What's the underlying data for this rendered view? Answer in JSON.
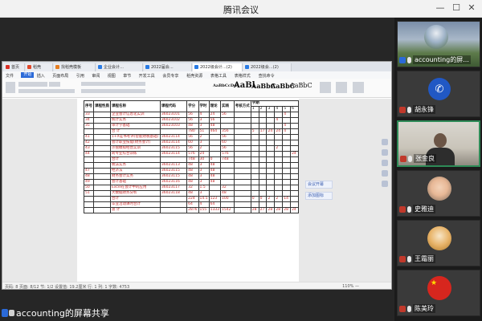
{
  "window": {
    "title": "腾讯会议",
    "minimize": "—",
    "maximize": "☐",
    "close": "✕"
  },
  "shared_screen": {
    "tabs": [
      {
        "label": "首页",
        "color": "#d93025"
      },
      {
        "label": "稻壳",
        "color": "#e0482a"
      },
      {
        "label": "找稻壳模板",
        "color": "#e67e22"
      },
      {
        "label": "企业会计…",
        "color": "#2a7be4"
      },
      {
        "label": "2022届会…",
        "color": "#2a7be4"
      },
      {
        "label": "2022级会计…(2)",
        "color": "#2a7be4"
      },
      {
        "label": "2022级会…(2)",
        "color": "#2a7be4"
      }
    ],
    "menu": [
      "文件",
      "开始",
      "插入",
      "页面布局",
      "引用",
      "审阅",
      "视图",
      "章节",
      "开发工具",
      "会员专享",
      "稻壳资源",
      "表格工具",
      "表格样式",
      "查找命令"
    ],
    "style_samples": [
      "AaBbCcDd",
      "AaBl",
      "AaBbC",
      "AaBbC",
      "AaBbC"
    ],
    "side_buttons": [
      "会议开幕",
      "添加图标"
    ],
    "table": {
      "headers": [
        "序号",
        "课程性质",
        "课程名称",
        "课程代码",
        "学分",
        "学时",
        "理论",
        "实践",
        "考核方式",
        "学期"
      ],
      "semesters": [
        "1",
        "2",
        "3",
        "4",
        "5",
        "6"
      ],
      "rows": [
        {
          "no": "33",
          "name": "企业会计信息化实训",
          "code": "36023101",
          "credit": "56",
          "hours": "4",
          "theory": "24",
          "practice": "56",
          "exam": "",
          "sem": [
            "",
            "",
            "",
            "",
            "4",
            ""
          ]
        },
        {
          "no": "34",
          "name": "统计实务",
          "code": "36023102",
          "credit": "56",
          "hours": "3",
          "theory": "56",
          "practice": "",
          "exam": "",
          "sem": [
            "",
            "",
            "",
            "4",
            "",
            ""
          ]
        },
        {
          "no": "35",
          "name": "审计学基础",
          "code": "36023103",
          "credit": "48",
          "hours": "3",
          "theory": "48",
          "practice": "",
          "exam": "",
          "sem": [
            "",
            "",
            "",
            "",
            "4",
            ""
          ]
        },
        {
          "no": "",
          "name": "合  计",
          "code": "",
          "credit": "780",
          "hours": "51",
          "theory": "464",
          "practice": "356",
          "exam": "",
          "sem": [
            "5",
            "17",
            "24",
            "24",
            "4",
            ""
          ]
        },
        {
          "no": "41",
          "name": "1+X证书考评(智能财税基础)",
          "code": "36023114",
          "credit": "56",
          "hours": "2",
          "theory": "",
          "practice": "56",
          "exam": "",
          "sem": [
            "",
            "",
            "",
            "",
            "",
            ""
          ]
        },
        {
          "no": "42",
          "name": "会计职业技能(财务会计)",
          "code": "36023114",
          "credit": "60",
          "hours": "3",
          "theory": "",
          "practice": "60",
          "exam": "",
          "sem": [
            "",
            "",
            "",
            "",
            "",
            ""
          ]
        },
        {
          "no": "43",
          "name": "沙盘模拟经营实训",
          "code": "36023115",
          "credit": "56",
          "hours": "2",
          "theory": "",
          "practice": "56",
          "exam": "",
          "sem": [
            "",
            "",
            "",
            "2",
            "",
            ""
          ]
        },
        {
          "no": "44",
          "name": "跨专业综合训练",
          "code": "36023114",
          "credit": "576",
          "hours": "24",
          "theory": "",
          "practice": "576",
          "exam": "",
          "sem": [
            "",
            "",
            "",
            "",
            "",
            "24"
          ]
        },
        {
          "no": "",
          "name": "合计",
          "code": "",
          "credit": "748",
          "hours": "30",
          "theory": "0",
          "practice": "748",
          "exam": "",
          "sem": [
            "",
            "",
            "",
            "",
            "",
            ""
          ]
        },
        {
          "no": "",
          "name": "税法实务",
          "code": "36023113",
          "credit": "48",
          "hours": "3",
          "theory": "48",
          "practice": "",
          "exam": "",
          "sem": [
            "",
            "",
            "",
            "",
            "",
            ""
          ]
        },
        {
          "no": "47",
          "name": "经济法",
          "code": "36023115",
          "credit": "48",
          "hours": "3",
          "theory": "48",
          "practice": "",
          "exam": "",
          "sem": [
            "",
            "",
            "",
            "",
            "",
            ""
          ]
        },
        {
          "no": "48",
          "name": "财务会计实务",
          "code": "36023115",
          "credit": "48",
          "hours": "3",
          "theory": "48",
          "practice": "",
          "exam": "",
          "sem": [
            "",
            "",
            "",
            "",
            "",
            ""
          ]
        },
        {
          "no": "49",
          "name": "会计基础",
          "code": "36023116",
          "credit": "48",
          "hours": "3",
          "theory": "48",
          "practice": "",
          "exam": "",
          "sem": [
            "",
            "",
            "",
            "",
            "",
            ""
          ]
        },
        {
          "no": "50",
          "name": "Excel在会计中的应用",
          "code": "36023117",
          "credit": "32",
          "hours": "1.5",
          "theory": "",
          "practice": "32",
          "exam": "",
          "sem": [
            "",
            "",
            "",
            "",
            "",
            ""
          ]
        },
        {
          "no": "51",
          "name": "大数据财务分析",
          "code": "36023118",
          "credit": "48",
          "hours": "3",
          "theory": "",
          "practice": "48",
          "exam": "",
          "sem": [
            "",
            "",
            "",
            "",
            "",
            ""
          ]
        },
        {
          "no": "",
          "name": "合计",
          "code": "",
          "credit": "224",
          "hours": "14.5",
          "theory": "123",
          "practice": "100",
          "exam": "",
          "sem": [
            "0",
            "0",
            "2",
            "2",
            "14",
            ""
          ]
        },
        {
          "no": "",
          "name": "毕业活动课时合计",
          "code": "",
          "credit": "64",
          "hours": "4",
          "theory": "64",
          "practice": "",
          "exam": "",
          "sem": [
            "",
            "",
            "",
            "",
            "",
            ""
          ]
        },
        {
          "no": "",
          "name": "总  计",
          "code": "",
          "credit": "2876",
          "hours": "155",
          "theory": "1333",
          "practice": "1542",
          "exam": "",
          "sem": [
            "28",
            "27",
            "28",
            "28",
            "28",
            "24"
          ]
        }
      ]
    },
    "status": {
      "left": "页码: 8  页面: 8/12  节: 1/2  设置值: 19.2厘米  行: 1  列: 1  字数: 4753",
      "right": "110% —"
    }
  },
  "share_banner": {
    "label": "accounting的屏幕共享"
  },
  "participants": [
    {
      "name": "accounting的屏...",
      "kind": "landscape",
      "speaking": false
    },
    {
      "name": "胡永锋",
      "kind": "phone",
      "speaking": false
    },
    {
      "name": "张金良",
      "kind": "camera",
      "speaking": true
    },
    {
      "name": "史雅迪",
      "kind": "baby",
      "speaking": false
    },
    {
      "name": "王霜丽",
      "kind": "child",
      "speaking": false
    },
    {
      "name": "陈美玲",
      "kind": "flag",
      "speaking": false
    }
  ],
  "colors": {
    "brand": "#2b6ad8",
    "speaking_border": "#2e8b57",
    "table_text": "#c62828"
  }
}
